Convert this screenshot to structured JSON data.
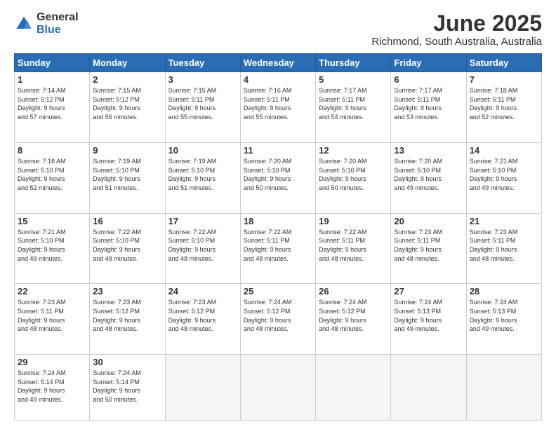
{
  "header": {
    "logo_general": "General",
    "logo_blue": "Blue",
    "title": "June 2025",
    "subtitle": "Richmond, South Australia, Australia"
  },
  "weekdays": [
    "Sunday",
    "Monday",
    "Tuesday",
    "Wednesday",
    "Thursday",
    "Friday",
    "Saturday"
  ],
  "weeks": [
    [
      {
        "day": "1",
        "info": "Sunrise: 7:14 AM\nSunset: 5:12 PM\nDaylight: 9 hours\nand 57 minutes."
      },
      {
        "day": "2",
        "info": "Sunrise: 7:15 AM\nSunset: 5:12 PM\nDaylight: 9 hours\nand 56 minutes."
      },
      {
        "day": "3",
        "info": "Sunrise: 7:15 AM\nSunset: 5:11 PM\nDaylight: 9 hours\nand 55 minutes."
      },
      {
        "day": "4",
        "info": "Sunrise: 7:16 AM\nSunset: 5:11 PM\nDaylight: 9 hours\nand 55 minutes."
      },
      {
        "day": "5",
        "info": "Sunrise: 7:17 AM\nSunset: 5:11 PM\nDaylight: 9 hours\nand 54 minutes."
      },
      {
        "day": "6",
        "info": "Sunrise: 7:17 AM\nSunset: 5:11 PM\nDaylight: 9 hours\nand 53 minutes."
      },
      {
        "day": "7",
        "info": "Sunrise: 7:18 AM\nSunset: 5:11 PM\nDaylight: 9 hours\nand 52 minutes."
      }
    ],
    [
      {
        "day": "8",
        "info": "Sunrise: 7:18 AM\nSunset: 5:10 PM\nDaylight: 9 hours\nand 52 minutes."
      },
      {
        "day": "9",
        "info": "Sunrise: 7:19 AM\nSunset: 5:10 PM\nDaylight: 9 hours\nand 51 minutes."
      },
      {
        "day": "10",
        "info": "Sunrise: 7:19 AM\nSunset: 5:10 PM\nDaylight: 9 hours\nand 51 minutes."
      },
      {
        "day": "11",
        "info": "Sunrise: 7:20 AM\nSunset: 5:10 PM\nDaylight: 9 hours\nand 50 minutes."
      },
      {
        "day": "12",
        "info": "Sunrise: 7:20 AM\nSunset: 5:10 PM\nDaylight: 9 hours\nand 50 minutes."
      },
      {
        "day": "13",
        "info": "Sunrise: 7:20 AM\nSunset: 5:10 PM\nDaylight: 9 hours\nand 49 minutes."
      },
      {
        "day": "14",
        "info": "Sunrise: 7:21 AM\nSunset: 5:10 PM\nDaylight: 9 hours\nand 49 minutes."
      }
    ],
    [
      {
        "day": "15",
        "info": "Sunrise: 7:21 AM\nSunset: 5:10 PM\nDaylight: 9 hours\nand 49 minutes."
      },
      {
        "day": "16",
        "info": "Sunrise: 7:22 AM\nSunset: 5:10 PM\nDaylight: 9 hours\nand 48 minutes."
      },
      {
        "day": "17",
        "info": "Sunrise: 7:22 AM\nSunset: 5:10 PM\nDaylight: 9 hours\nand 48 minutes."
      },
      {
        "day": "18",
        "info": "Sunrise: 7:22 AM\nSunset: 5:11 PM\nDaylight: 9 hours\nand 48 minutes."
      },
      {
        "day": "19",
        "info": "Sunrise: 7:22 AM\nSunset: 5:11 PM\nDaylight: 9 hours\nand 48 minutes."
      },
      {
        "day": "20",
        "info": "Sunrise: 7:23 AM\nSunset: 5:11 PM\nDaylight: 9 hours\nand 48 minutes."
      },
      {
        "day": "21",
        "info": "Sunrise: 7:23 AM\nSunset: 5:11 PM\nDaylight: 9 hours\nand 48 minutes."
      }
    ],
    [
      {
        "day": "22",
        "info": "Sunrise: 7:23 AM\nSunset: 5:11 PM\nDaylight: 9 hours\nand 48 minutes."
      },
      {
        "day": "23",
        "info": "Sunrise: 7:23 AM\nSunset: 5:12 PM\nDaylight: 9 hours\nand 48 minutes."
      },
      {
        "day": "24",
        "info": "Sunrise: 7:23 AM\nSunset: 5:12 PM\nDaylight: 9 hours\nand 48 minutes."
      },
      {
        "day": "25",
        "info": "Sunrise: 7:24 AM\nSunset: 5:12 PM\nDaylight: 9 hours\nand 48 minutes."
      },
      {
        "day": "26",
        "info": "Sunrise: 7:24 AM\nSunset: 5:12 PM\nDaylight: 9 hours\nand 48 minutes."
      },
      {
        "day": "27",
        "info": "Sunrise: 7:24 AM\nSunset: 5:13 PM\nDaylight: 9 hours\nand 49 minutes."
      },
      {
        "day": "28",
        "info": "Sunrise: 7:24 AM\nSunset: 5:13 PM\nDaylight: 9 hours\nand 49 minutes."
      }
    ],
    [
      {
        "day": "29",
        "info": "Sunrise: 7:24 AM\nSunset: 5:14 PM\nDaylight: 9 hours\nand 49 minutes."
      },
      {
        "day": "30",
        "info": "Sunrise: 7:24 AM\nSunset: 5:14 PM\nDaylight: 9 hours\nand 50 minutes."
      },
      {
        "day": "",
        "info": ""
      },
      {
        "day": "",
        "info": ""
      },
      {
        "day": "",
        "info": ""
      },
      {
        "day": "",
        "info": ""
      },
      {
        "day": "",
        "info": ""
      }
    ]
  ]
}
